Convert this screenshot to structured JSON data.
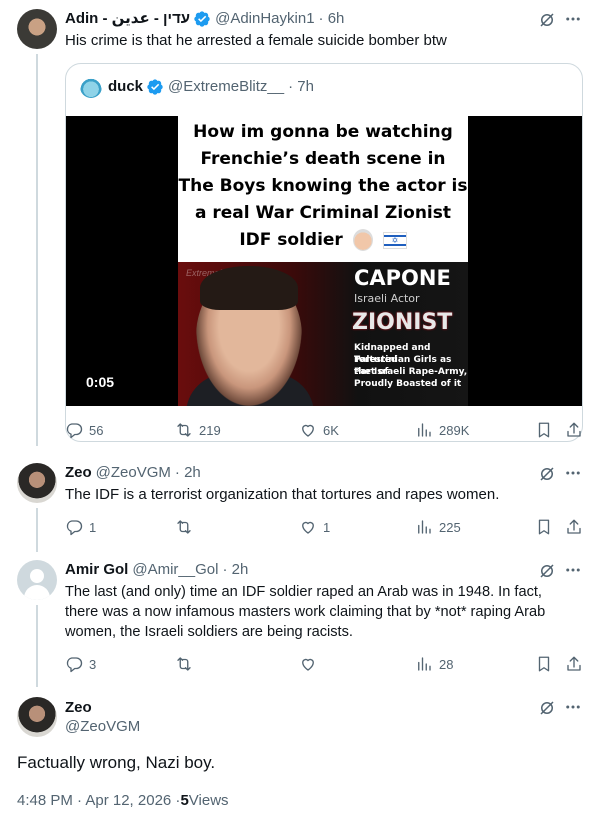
{
  "tweets": [
    {
      "name": "Adin - עדין - عدين",
      "handle": "@AdinHaykin1",
      "time": "· 6h",
      "text": "His crime is that he arrested a female suicide bomber btw",
      "quote": {
        "name": "duck",
        "handle": "@ExtremeBlitz__",
        "time": "· 7h",
        "meme_lines": [
          "How im gonna be watching",
          "Frenchie’s death scene in",
          "The Boys knowing the actor is",
          "a real War Criminal Zionist",
          "IDF soldier"
        ],
        "watermark": "ExtremeBlitz",
        "capone": "CAPONE",
        "israeli_actor": "Israeli Actor",
        "zionist": "ZIONIST",
        "caption_lines": [
          "Kidnapped and Tortured",
          "Palestinian Girls as Part of",
          "the Israeli Rape-Army,",
          "Proudly Boasted of it"
        ],
        "duration": "0:05"
      },
      "actions": {
        "replies": "56",
        "reposts": "219",
        "likes": "6K",
        "views": "289K"
      }
    },
    {
      "name": "Zeo",
      "handle": "@ZeoVGM",
      "time": "· 2h",
      "text": "The IDF is a terrorist organization that tortures and rapes women.",
      "actions": {
        "replies": "1",
        "reposts": "",
        "likes": "1",
        "views": "225"
      }
    },
    {
      "name": "Amir Gol",
      "handle": "@Amir__Gol",
      "time": "· 2h",
      "text_lines": [
        "The last (and only) time an IDF soldier raped an Arab was in 1948. In fact,",
        "there was a now infamous masters work claiming that by *not* raping Arab",
        "women, the Israeli soldiers are being racists."
      ],
      "actions": {
        "replies": "3",
        "reposts": "",
        "likes": "",
        "views": "28"
      }
    }
  ],
  "main_tweet": {
    "name": "Zeo",
    "handle": "@ZeoVGM",
    "text": "Factually wrong, Nazi boy.",
    "timestamp": "4:48 PM · Apr 12, 2026 · ",
    "views_count": "5",
    "views_label": " Views"
  },
  "colors": {
    "verified": "#1d9bf0",
    "text": "#0f1419",
    "secondary": "#536471",
    "border": "#cfd9de"
  },
  "icons": [
    "grok-icon",
    "more-icon",
    "reply-icon",
    "repost-icon",
    "like-icon",
    "views-icon",
    "bookmark-icon",
    "share-icon",
    "verified-badge-icon"
  ]
}
